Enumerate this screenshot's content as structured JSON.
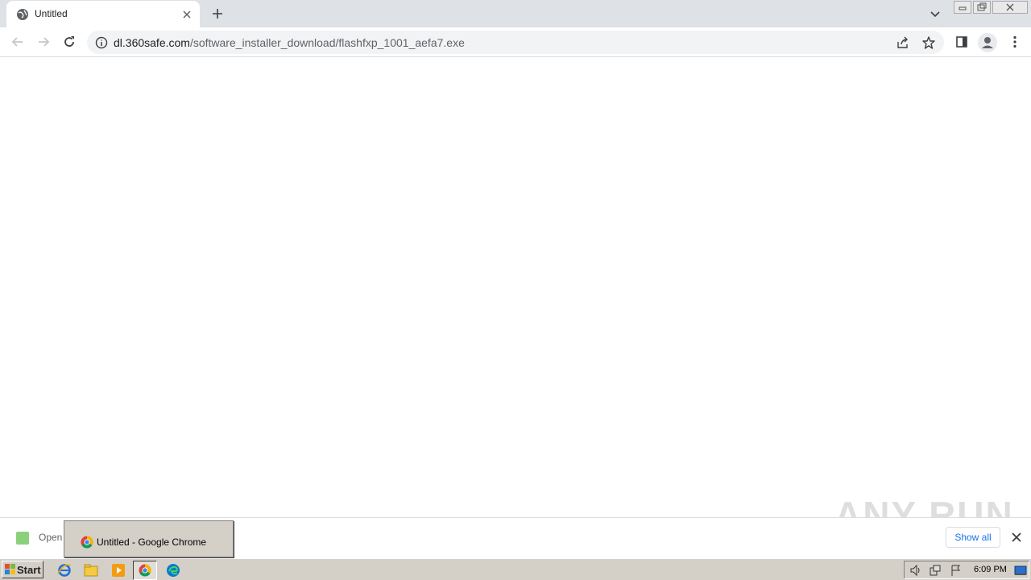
{
  "browser": {
    "tab_title": "Untitled",
    "url_host": "dl.360safe.com",
    "url_path": "/software_installer_download/flashfxp_1001_aefa7.exe"
  },
  "download_shelf": {
    "item_text": "Open",
    "show_all_label": "Show all"
  },
  "taskbar_preview": {
    "title": "Untitled - Google Chrome"
  },
  "watermark": "ANY RUN",
  "taskbar": {
    "start_label": "Start",
    "clock": "6:09 PM"
  }
}
